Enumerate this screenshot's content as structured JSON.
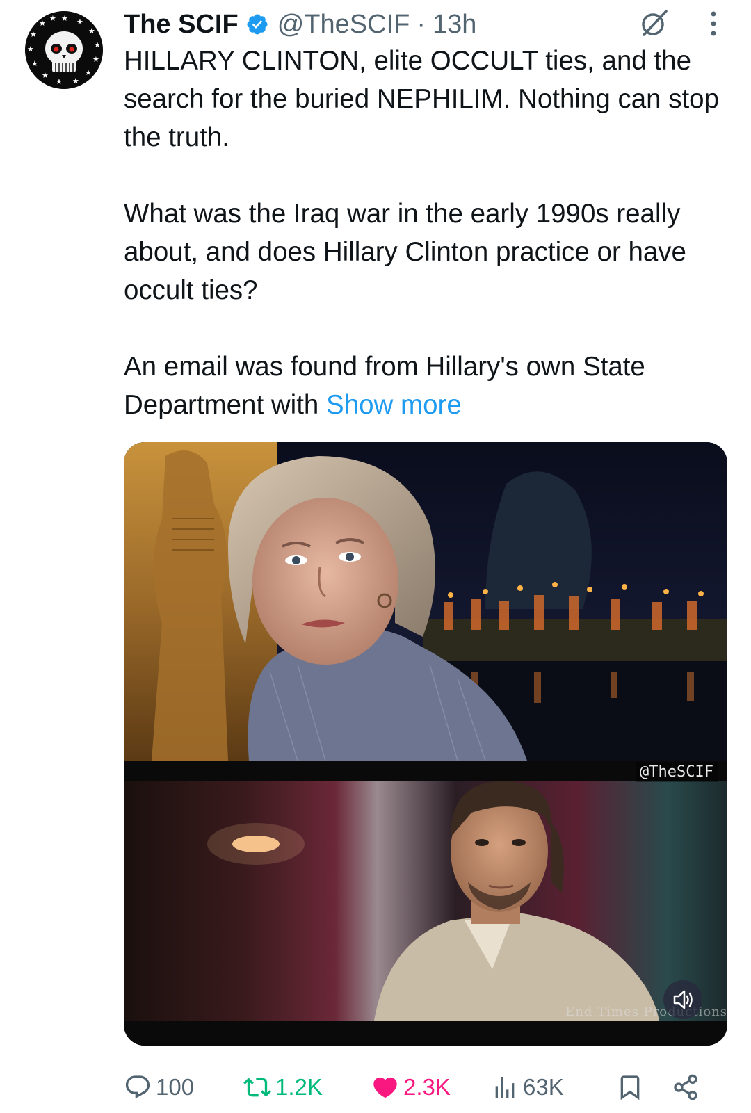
{
  "tweet": {
    "author": {
      "display_name": "The SCIF",
      "handle": "@TheSCIF",
      "verified": true,
      "avatar_icon": "skull-stars-avatar"
    },
    "separator": "·",
    "time_ago": "13h",
    "text": {
      "paragraph_1": "HILLARY CLINTON, elite OCCULT ties, and the search for the buried NEPHILIM. Nothing can stop the truth.",
      "paragraph_2": "What was the Iraq war in the early 1990s really about, and does Hillary Clinton practice or have occult ties?",
      "paragraph_3": "An email was found from Hillary's own State Department with ",
      "show_more": "Show more"
    },
    "media": {
      "watermark": "@TheSCIF",
      "credit_overlay": "End Times Productions",
      "volume_icon": "speaker-volume-icon"
    },
    "actions": {
      "replies": "100",
      "reposts": "1.2K",
      "likes": "2.3K",
      "views": "63K"
    }
  },
  "colors": {
    "text": "#0f1419",
    "secondary": "#536471",
    "link": "#1d9bf0",
    "verified": "#1d9bf0",
    "like": "#f91880",
    "repost": "#00ba7c"
  }
}
